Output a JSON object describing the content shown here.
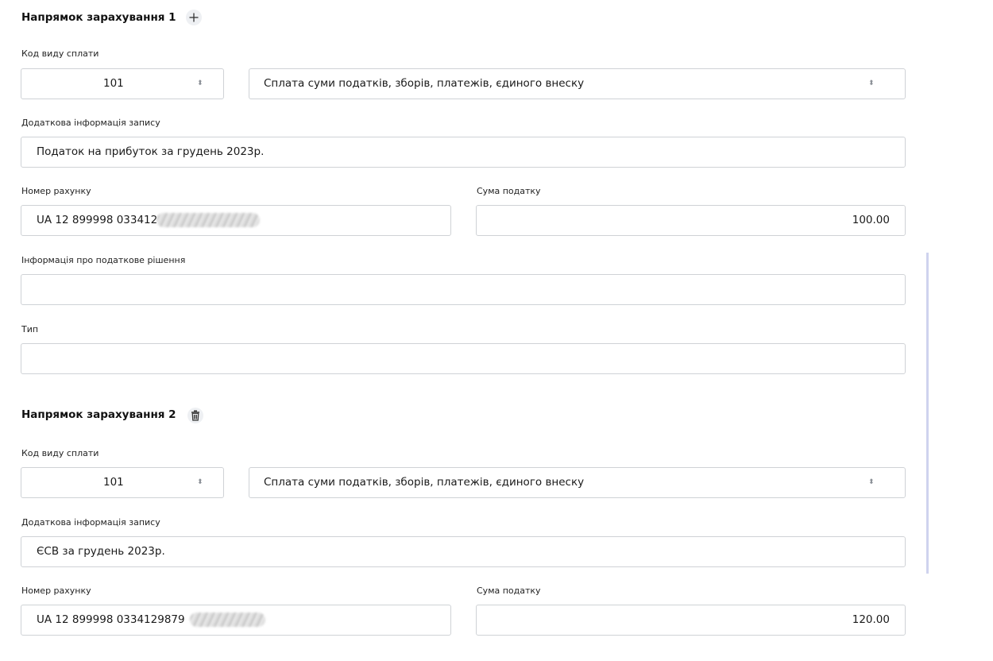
{
  "sections": [
    {
      "title": "Напрямок зарахування 1",
      "action_icon": "plus-icon",
      "payment_code_label": "Код виду сплати",
      "payment_code": "101",
      "payment_description": "Сплата суми податків, зборів, платежів, єдиного внеску",
      "extra_info_label": "Додаткова інформація запису",
      "extra_info": "Податок на прибуток за грудень 2023р.",
      "account_label": "Номер рахунку",
      "account": "UA 12 899998 033412",
      "amount_label": "Сума податку",
      "amount": "100.00",
      "tax_decision_label": "Інформація про податкове рішення",
      "tax_decision": "",
      "type_label": "Тип",
      "type": ""
    },
    {
      "title": "Напрямок зарахування 2",
      "action_icon": "trash-icon",
      "payment_code_label": "Код виду сплати",
      "payment_code": "101",
      "payment_description": "Сплата суми податків, зборів, платежів, єдиного внеску",
      "extra_info_label": "Додаткова інформація запису",
      "extra_info": "ЄСВ за грудень 2023р.",
      "account_label": "Номер рахунку",
      "account": "UA 12 899998 0334129879",
      "amount_label": "Сума податку",
      "amount": "120.00"
    }
  ],
  "spinner_icon": "sort-arrows-icon"
}
